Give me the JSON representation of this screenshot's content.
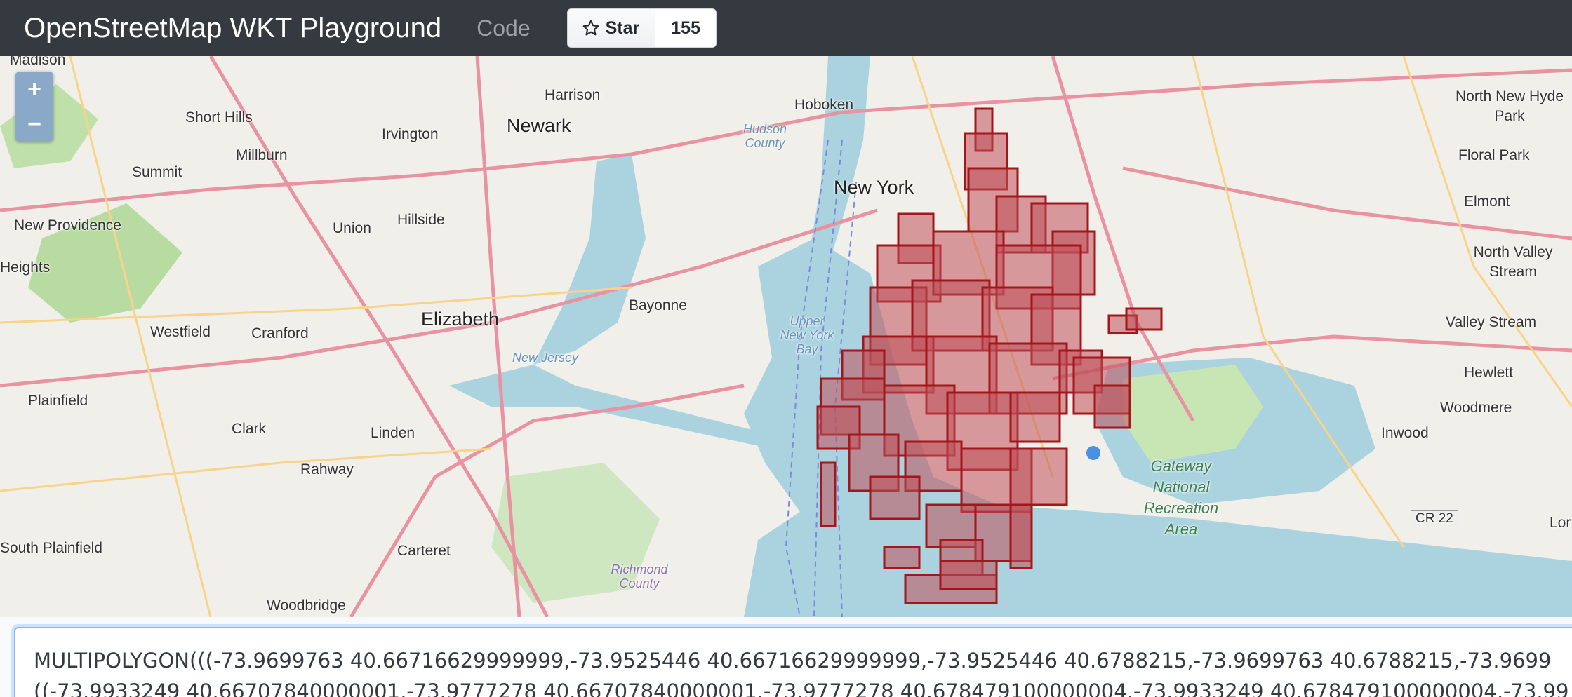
{
  "navbar": {
    "title": "OpenStreetMap WKT Playground",
    "code_link": "Code",
    "star_label": "Star",
    "star_count": "155"
  },
  "map": {
    "zoom_in": "+",
    "zoom_out": "−",
    "labels": {
      "madison": "Madison",
      "short_hills": "Short Hills",
      "summit": "Summit",
      "millburn": "Millburn",
      "irvington": "Irvington",
      "newark": "Newark",
      "harrison": "Harrison",
      "hoboken": "Hoboken",
      "hudson_county": "Hudson County",
      "new_york": "New York",
      "new_providence": "New Providence",
      "union": "Union",
      "hillside": "Hillside",
      "heights": "Heights",
      "westfield": "Westfield",
      "cranford": "Cranford",
      "elizabeth": "Elizabeth",
      "bayonne": "Bayonne",
      "upper_new_york_bay": "Upper New York Bay",
      "new_jersey": "New Jersey",
      "plainfield": "Plainfield",
      "clark": "Clark",
      "linden": "Linden",
      "rahway": "Rahway",
      "carteret": "Carteret",
      "south_plainfield": "South Plainfield",
      "woodbridge": "Woodbridge",
      "richmond_county": "Richmond County",
      "gateway": "Gateway National Recreation Area",
      "north_new_hyde_park": "North New Hyde Park",
      "floral_park": "Floral Park",
      "elmont": "Elmont",
      "north_valley_stream": "North Valley Stream",
      "valley_stream": "Valley Stream",
      "hewlett": "Hewlett",
      "woodmere": "Woodmere",
      "inwood": "Inwood",
      "cr22": "CR 22",
      "lor": "Lor"
    }
  },
  "wkt": {
    "line1": "MULTIPOLYGON(((-73.9699763 40.66716629999999,-73.9525446 40.66716629999999,-73.9525446 40.6788215,-73.9699763 40.6788215,-73.9699",
    "line2": "((-73.9933249 40.66707840000001,-73.9777278 40.66707840000001,-73.9777278 40.678479100000004,-73.9933249 40.678479100000004,-73.99"
  },
  "colors": {
    "navbar": "#343a40",
    "polygon_stroke": "#a3161b",
    "polygon_fill": "#c0505a",
    "water": "#aad3df",
    "park": "#c8e6b4",
    "road": "#e892a2"
  }
}
